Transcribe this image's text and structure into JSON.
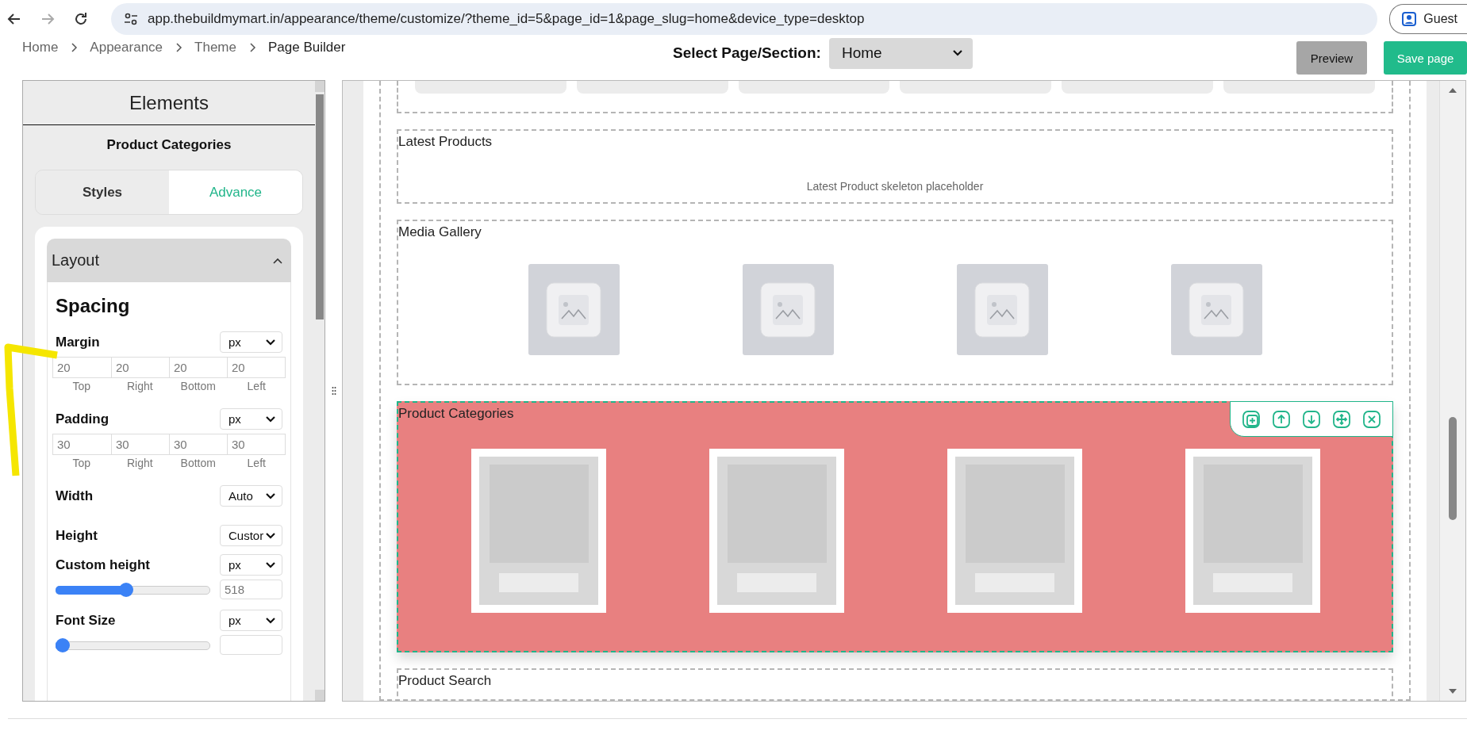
{
  "browser": {
    "url": "app.thebuildmymart.in/appearance/theme/customize/?theme_id=5&page_id=1&page_slug=home&device_type=desktop",
    "profile": "Guest"
  },
  "breadcrumb": [
    "Home",
    "Appearance",
    "Theme",
    "Page Builder"
  ],
  "page_select": {
    "label": "Select Page/Section:",
    "value": "Home"
  },
  "buttons": [
    {
      "kind": "secondary",
      "label": "Preview"
    },
    {
      "kind": "primary",
      "label": "Save page"
    }
  ],
  "sidebar": {
    "title": "Elements",
    "element": "Product Categories",
    "tabs": [
      {
        "label": "Styles",
        "selected": false
      },
      {
        "label": "Advance",
        "selected": true
      }
    ],
    "section": {
      "title": "Layout",
      "expanded": true,
      "heading": "Spacing",
      "rows": [
        {
          "kind": "sides",
          "label": "Margin",
          "unit": "px",
          "values": [
            "20",
            "20",
            "20",
            "20"
          ],
          "sides": [
            "Top",
            "Right",
            "Bottom",
            "Left"
          ]
        },
        {
          "kind": "sides",
          "label": "Padding",
          "unit": "px",
          "values": [
            "30",
            "30",
            "30",
            "30"
          ],
          "sides": [
            "Top",
            "Right",
            "Bottom",
            "Left"
          ]
        },
        {
          "kind": "select",
          "label": "Width",
          "value": "Auto"
        },
        {
          "kind": "select",
          "label": "Height",
          "value": "Custor"
        },
        {
          "kind": "slider",
          "label": "Custom height",
          "unit": "px",
          "level": 0.45,
          "value": "518"
        },
        {
          "kind": "slider",
          "label": "Font Size",
          "unit": "px",
          "level": 0
        }
      ]
    }
  },
  "canvas": {
    "sections": [
      {
        "kind": "skeleton-row",
        "selected": false
      },
      {
        "kind": "text",
        "title": "Latest Products",
        "text": "Latest Product skeleton placeholder",
        "selected": false
      },
      {
        "kind": "gallery",
        "title": "Media Gallery",
        "selected": false
      },
      {
        "kind": "categories",
        "title": "Product Categories",
        "selected": true
      },
      {
        "kind": "text",
        "title": "Product Search",
        "selected": false
      }
    ]
  }
}
